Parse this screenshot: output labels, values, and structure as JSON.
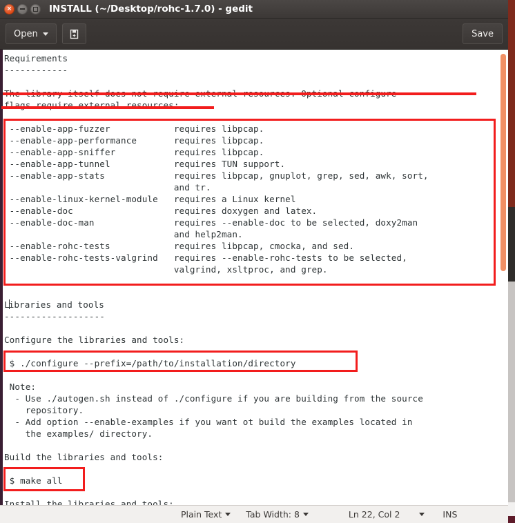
{
  "window": {
    "title": "INSTALL (~/Desktop/rohc-1.7.0) - gedit",
    "controls": {
      "close_label": "×",
      "minimize_label": "",
      "maximize_label": ""
    }
  },
  "toolbar": {
    "open_label": "Open",
    "new_doc_label": "",
    "save_label": "Save"
  },
  "document": {
    "lines": [
      "Requirements",
      "------------",
      "",
      "The library itself does not require external resources. Optional configure",
      "flags require external resources:",
      "",
      " --enable-app-fuzzer            requires libpcap.",
      " --enable-app-performance       requires libpcap.",
      " --enable-app-sniffer           requires libpcap.",
      " --enable-app-tunnel            requires TUN support.",
      " --enable-app-stats             requires libpcap, gnuplot, grep, sed, awk, sort,",
      "                                and tr.",
      " --enable-linux-kernel-module   requires a Linux kernel",
      " --enable-doc                   requires doxygen and latex.",
      " --enable-doc-man               requires --enable-doc to be selected, doxy2man",
      "                                and help2man.",
      " --enable-rohc-tests            requires libpcap, cmocka, and sed.",
      " --enable-rohc-tests-valgrind   requires --enable-rohc-tests to be selected,",
      "                                valgrind, xsltproc, and grep.",
      "",
      "",
      "Libraries and tools",
      "-------------------",
      "",
      "Configure the libraries and tools:",
      "",
      " $ ./configure --prefix=/path/to/installation/directory",
      "",
      " Note:",
      "  - Use ./autogen.sh instead of ./configure if you are building from the source",
      "    repository.",
      "  - Add option --enable-examples if you want ot build the examples located in",
      "    the examples/ directory.",
      "",
      "Build the libraries and tools:",
      "",
      " $ make all",
      "",
      "Install the libraries and tools:"
    ],
    "caret_line_index": 21,
    "caret_col_chars": 1
  },
  "annotations": {
    "color": "#f21d1d",
    "items": [
      {
        "name": "underline-intro-line-1",
        "type": "line"
      },
      {
        "name": "underline-intro-line-2",
        "type": "line"
      },
      {
        "name": "box-enable-flags-list",
        "type": "box"
      },
      {
        "name": "box-configure-command",
        "type": "box"
      },
      {
        "name": "box-make-all-command",
        "type": "box"
      }
    ]
  },
  "statusbar": {
    "language": "Plain Text",
    "tab_width": "Tab Width: 8",
    "position": "Ln 22, Col 2",
    "insert_mode": "INS"
  },
  "colors": {
    "titlebar": "#3c3836",
    "toolbar": "#3a3634",
    "close_button": "#dd4814",
    "scrollbar": "#f08a5d",
    "annotation_red": "#f21d1d",
    "text": "#2e3436",
    "left_strip": "#3a1f33"
  }
}
